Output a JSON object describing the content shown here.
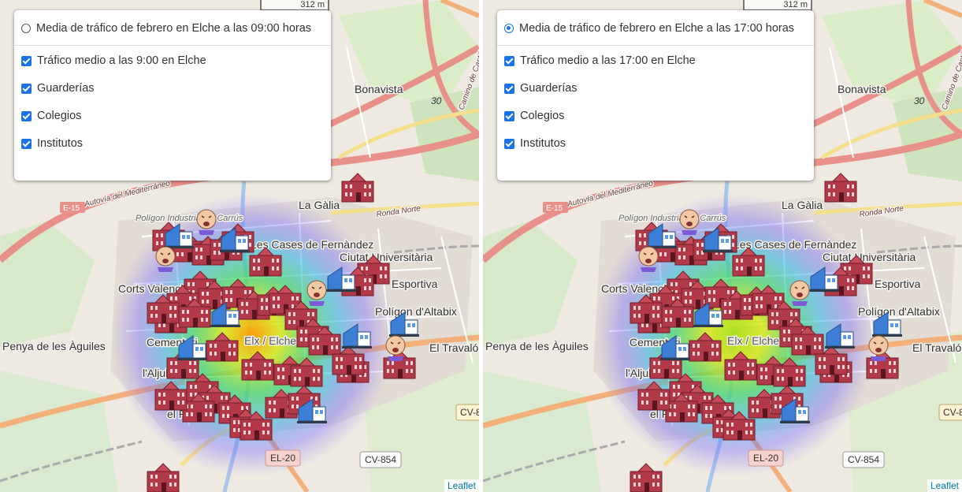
{
  "maps": [
    {
      "base_layer": {
        "label": "Media de tráfico de febrero en Elche a las 09:00 horas",
        "checked": false
      },
      "overlays": [
        {
          "label": "Tráfico medio a las 9:00 en Elche",
          "checked": true
        },
        {
          "label": "Guarderías",
          "checked": true
        },
        {
          "label": "Colegios",
          "checked": true
        },
        {
          "label": "Institutos",
          "checked": true
        }
      ],
      "scale": "312 m",
      "attribution": "Leaflet",
      "heatmap_intensity": "high"
    },
    {
      "base_layer": {
        "label": "Media de tráfico de febrero en Elche a las 17:00 horas",
        "checked": true
      },
      "overlays": [
        {
          "label": "Tráfico medio a las 17:00 en Elche",
          "checked": true
        },
        {
          "label": "Guarderías",
          "checked": true
        },
        {
          "label": "Colegios",
          "checked": true
        },
        {
          "label": "Institutos",
          "checked": true
        }
      ],
      "scale": "312 m",
      "attribution": "Leaflet",
      "heatmap_intensity": "medium"
    }
  ],
  "place_labels": {
    "bonavista": "Bonavista",
    "la_galia": "La Gàlia",
    "ronda_norte": "Ronda Norte",
    "poligon_industrial": "Polígon Industrial de Carrús",
    "cases_fernandez": "Les Cases de Fernàndez",
    "ciutat_universitaria": "Ciutat Universitària",
    "esportiva": "Esportiva",
    "corts_valenciana": "Corts Valenciana",
    "poligon_altabix": "Polígon d'Altabix",
    "el_travalo": "El Travalón",
    "penya_aguiles": "Penya de les Àguiles",
    "cementeri": "Cementeri",
    "aljub": "l'Aljub",
    "elx": "Elx / Elche",
    "el_pla": "el Pla",
    "autovia": "Autovía del Mediterráneo",
    "camino_castilla": "Camino de Castilla"
  },
  "road_shields": {
    "el20": "EL-20",
    "cv854": "CV-854",
    "cv8": "CV-8",
    "e15": "E-15",
    "r30": "30"
  },
  "icons": {
    "school": "school-icon",
    "nursery": "nursery-baby-icon",
    "institute": "institute-building-icon"
  },
  "colors": {
    "checkbox_blue": "#1a73e8",
    "heat_core_high": "#ff9a00",
    "heat_core_med": "#a8e01a",
    "school_red": "#b23a48",
    "institute_blue": "#3d7fd6",
    "link": "#0078a8"
  }
}
